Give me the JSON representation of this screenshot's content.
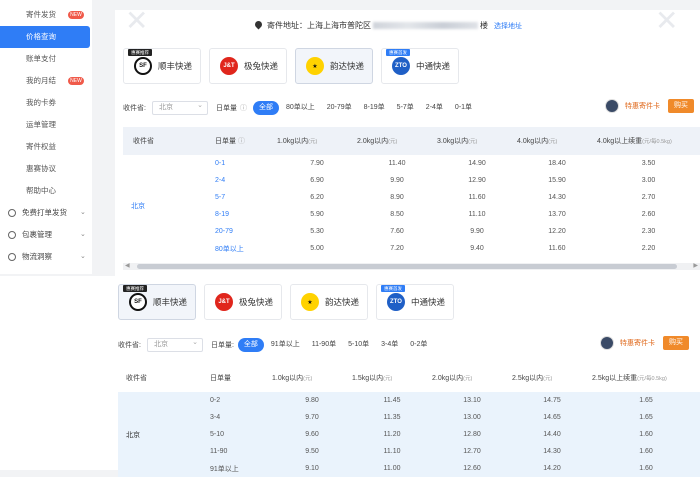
{
  "sidebar": {
    "items": [
      {
        "label": "寄件发货",
        "badge": "NEW"
      },
      {
        "label": "价格查询",
        "active": true
      },
      {
        "label": "账单支付"
      },
      {
        "label": "我的月结",
        "badge": "NEW"
      },
      {
        "label": "我的卡券"
      },
      {
        "label": "运单管理"
      },
      {
        "label": "寄件权益"
      },
      {
        "label": "惠赛协议"
      },
      {
        "label": "帮助中心"
      }
    ],
    "groups": [
      {
        "label": "免费打单发货"
      },
      {
        "label": "包裹管理"
      },
      {
        "label": "物流洞察"
      }
    ]
  },
  "address": {
    "prefix": "寄件地址：上海上海市普陀区",
    "suffix": "楼",
    "link": "选择地址"
  },
  "carriers": [
    {
      "name": "顺丰快递",
      "logo": "SF",
      "tag": "惠赛推荐"
    },
    {
      "name": "极兔快递",
      "logo": "J&T"
    },
    {
      "name": "韵达快递",
      "logo": "★"
    },
    {
      "name": "中通快递",
      "logo": "ZTO",
      "tag": "惠赛首发"
    }
  ],
  "panel1": {
    "origin_label": "收件省:",
    "origin_value": "北京",
    "volume_label": "日单量",
    "pills": [
      "全部",
      "80单以上",
      "20-79单",
      "8-19单",
      "5-7单",
      "2-4单",
      "0-1单"
    ],
    "promo_text": "特惠寄件卡",
    "promo_button": "购买",
    "headers": [
      "收件省",
      "日单量",
      "1.0kg以内",
      "2.0kg以内",
      "3.0kg以内",
      "4.0kg以内",
      "4.0kg以上续重"
    ],
    "header_units": [
      "",
      "",
      "(元)",
      "(元)",
      "(元)",
      "(元)",
      "(元/每0.5kg)"
    ],
    "city": "北京",
    "rows": [
      [
        "0-1",
        "7.90",
        "11.40",
        "14.90",
        "18.40",
        "3.50"
      ],
      [
        "2-4",
        "6.90",
        "9.90",
        "12.90",
        "15.90",
        "3.00"
      ],
      [
        "5-7",
        "6.20",
        "8.90",
        "11.60",
        "14.30",
        "2.70"
      ],
      [
        "8-19",
        "5.90",
        "8.50",
        "11.10",
        "13.70",
        "2.60"
      ],
      [
        "20-79",
        "5.30",
        "7.60",
        "9.90",
        "12.20",
        "2.30"
      ],
      [
        "80单以上",
        "5.00",
        "7.20",
        "9.40",
        "11.60",
        "2.20"
      ]
    ]
  },
  "panel2": {
    "origin_label": "收件省:",
    "origin_value": "北京",
    "volume_label": "日单量:",
    "pills": [
      "全部",
      "91单以上",
      "11-90单",
      "5-10单",
      "3-4单",
      "0-2单"
    ],
    "promo_text": "特惠寄件卡",
    "promo_button": "购买",
    "headers": [
      "收件省",
      "日单量",
      "1.0kg以内",
      "1.5kg以内",
      "2.0kg以内",
      "2.5kg以内",
      "2.5kg以上续重"
    ],
    "header_units": [
      "",
      "",
      "(元)",
      "(元)",
      "(元)",
      "(元)",
      "(元/每0.5kg)"
    ],
    "city": "北京",
    "rows": [
      [
        "0-2",
        "9.80",
        "11.45",
        "13.10",
        "14.75",
        "1.65"
      ],
      [
        "3-4",
        "9.70",
        "11.35",
        "13.00",
        "14.65",
        "1.65"
      ],
      [
        "5-10",
        "9.60",
        "11.20",
        "12.80",
        "14.40",
        "1.60"
      ],
      [
        "11-90",
        "9.50",
        "11.10",
        "12.70",
        "14.30",
        "1.60"
      ],
      [
        "91单以上",
        "9.10",
        "11.00",
        "12.60",
        "14.20",
        "1.60"
      ]
    ]
  }
}
